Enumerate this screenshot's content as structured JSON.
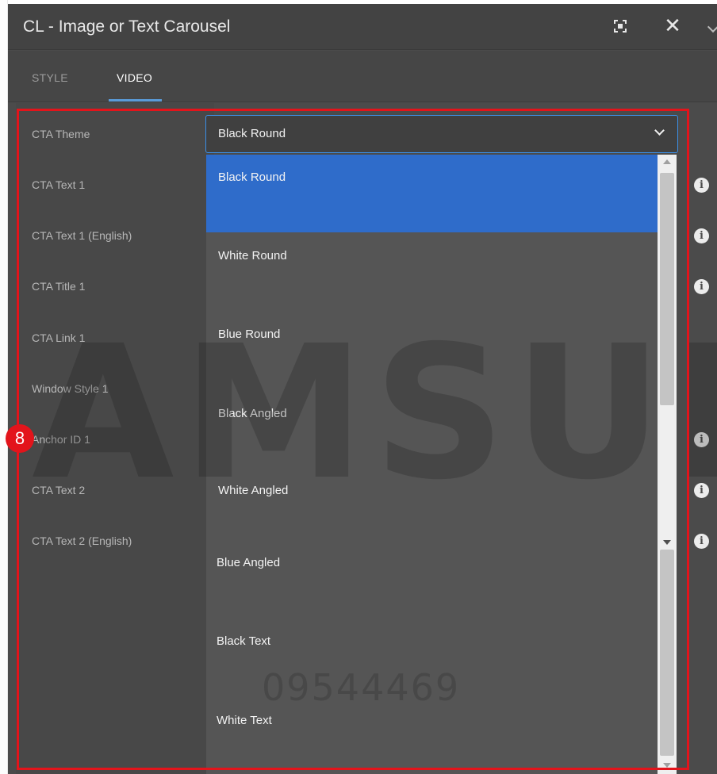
{
  "dialog": {
    "title": "CL - Image or Text Carousel",
    "fullscreen_icon": "fullscreen-icon",
    "close_icon": "close-icon",
    "close_glyph": "✕",
    "more_icon": "chevron-icon"
  },
  "tabs": [
    {
      "label": "STYLE",
      "active": false
    },
    {
      "label": "VIDEO",
      "active": true
    }
  ],
  "fields": [
    {
      "label": "CTA Theme",
      "info": false
    },
    {
      "label": "CTA Text 1",
      "info": true
    },
    {
      "label": "CTA Text 1 (English)",
      "info": true
    },
    {
      "label": "CTA Title 1",
      "info": true
    },
    {
      "label": "CTA Link 1",
      "info": false
    },
    {
      "label": "Window Style 1",
      "info": false
    },
    {
      "label": "Anchor ID 1",
      "info": true
    },
    {
      "label": "CTA Text 2",
      "info": true
    },
    {
      "label": "CTA Text 2 (English)",
      "info": true
    }
  ],
  "info_glyph": "i",
  "select": {
    "value": "Black Round",
    "options": [
      "Black Round",
      "White Round",
      "Blue Round",
      "Black Angled",
      "White Angled",
      "Blue Angled",
      "Black Text",
      "White Text"
    ],
    "selected_index": 0
  },
  "annotation": {
    "step_number": "8",
    "color": "#e3141b"
  },
  "watermark": {
    "text": "AMSUN",
    "number": "09544469"
  },
  "colors": {
    "accent": "#3b8fe6",
    "selected_option": "#2f6cca",
    "panel": "#4b4b4b"
  }
}
